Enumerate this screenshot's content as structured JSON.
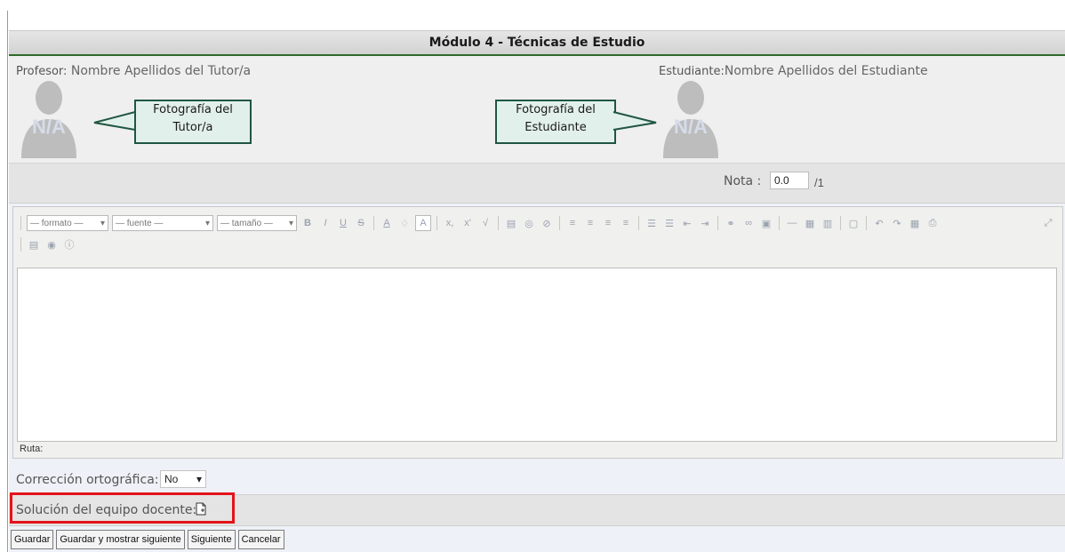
{
  "header": {
    "title": "Módulo 4 - Técnicas de Estudio"
  },
  "professor": {
    "label": "Profesor:",
    "name": "Nombre Apellidos del Tutor/a",
    "avatar_text": "N/A"
  },
  "student": {
    "label": "Estudiante:",
    "name": "Nombre Apellidos del Estudiante",
    "avatar_text": "N/A"
  },
  "callouts": {
    "tutor": "Fotografía del Tutor/a",
    "student": "Fotografía del Estudiante"
  },
  "grade": {
    "label": "Nota :",
    "value": "0.0",
    "total": "/1"
  },
  "editor": {
    "format_select": "— formato —",
    "font_select": "— fuente —",
    "size_select": "— tamaño —",
    "path_label": "Ruta:"
  },
  "spellcheck": {
    "label": "Corrección ortográfica:",
    "value": "No"
  },
  "solution": {
    "label": "Solución del equipo docente:"
  },
  "buttons": {
    "save": "Guardar",
    "save_next": "Guardar y mostrar siguiente",
    "next": "Siguiente",
    "cancel": "Cancelar"
  },
  "colors": {
    "title_underline": "#2e6b2a",
    "highlight": "#e3131b",
    "callout_border": "#1f5641",
    "callout_fill": "#e2f0ec"
  }
}
